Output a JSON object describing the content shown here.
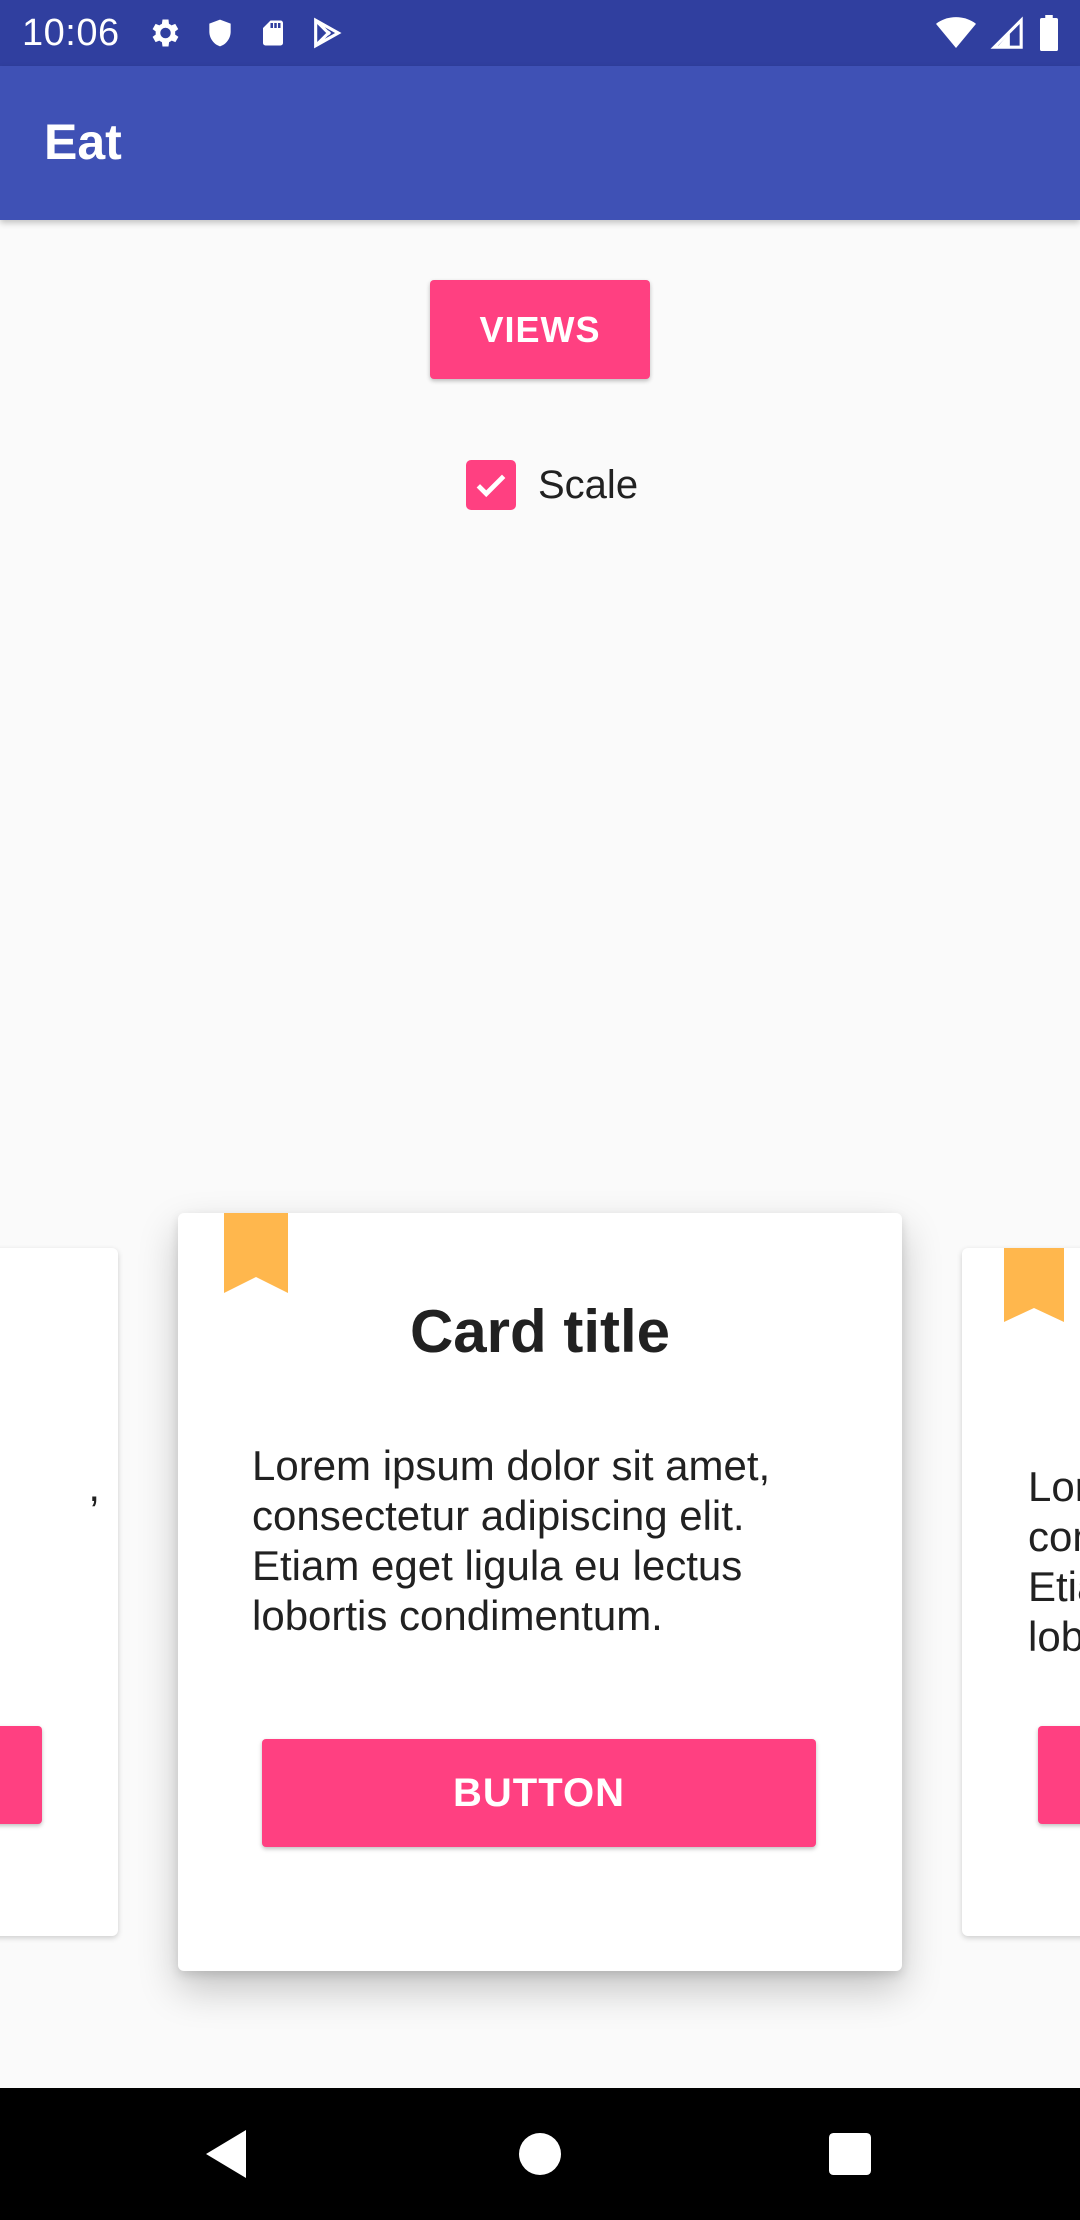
{
  "status_bar": {
    "time": "10:06",
    "icons_left": [
      "gear-icon",
      "shield-icon",
      "sd-card-icon",
      "play-store-icon"
    ],
    "icons_right": [
      "wifi-icon",
      "signal-icon",
      "battery-icon"
    ]
  },
  "app_bar": {
    "title": "Eat"
  },
  "controls": {
    "views_label": "VIEWS",
    "scale_label": "Scale",
    "scale_checked": true
  },
  "cards": {
    "main": {
      "title": "Card title",
      "body": "Lorem ipsum dolor sit amet, consectetur adipiscing elit. Etiam eget ligula eu lectus lobortis condimentum.",
      "button_label": "BUTTON",
      "icon": "bookmark-icon"
    },
    "left_partial": {
      "body_fragment": ","
    },
    "right_partial": {
      "line1": "Lor",
      "line2": "con",
      "line3": "Etia",
      "line4": "lob",
      "icon": "bookmark-icon"
    }
  },
  "nav_bar": {
    "buttons": [
      "back-icon",
      "home-icon",
      "recents-icon"
    ]
  },
  "colors": {
    "status_bar": "#303f9f",
    "app_bar": "#3f51b5",
    "accent": "#ff4081",
    "bookmark": "#ffb74d",
    "background": "#fafafa"
  }
}
